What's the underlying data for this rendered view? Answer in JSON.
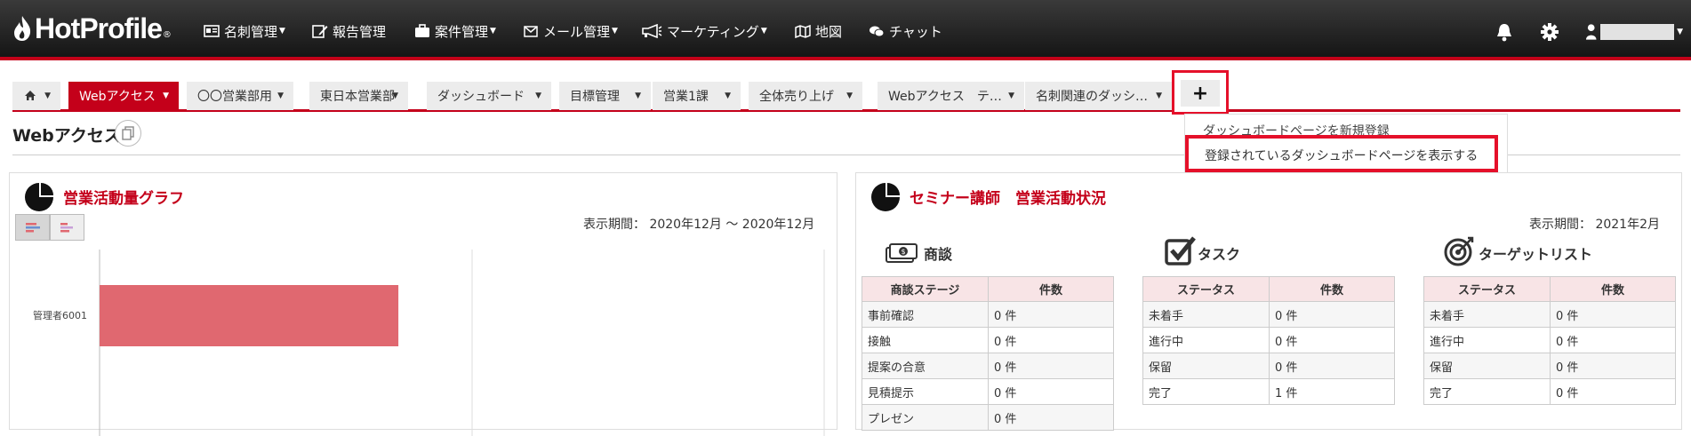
{
  "header": {
    "logo_text": "HotProfile",
    "logo_mark": "®",
    "nav": [
      {
        "label": "名刺管理",
        "icon": "card-icon",
        "caret": true
      },
      {
        "label": "報告管理",
        "icon": "report-icon",
        "caret": false
      },
      {
        "label": "案件管理",
        "icon": "briefcase-icon",
        "caret": true
      },
      {
        "label": "メール管理",
        "icon": "mail-icon",
        "caret": true
      },
      {
        "label": "マーケティング",
        "icon": "megaphone-icon",
        "caret": true
      },
      {
        "label": "地図",
        "icon": "map-icon",
        "caret": false
      },
      {
        "label": "チャット",
        "icon": "chat-icon",
        "caret": false
      }
    ]
  },
  "tabs": [
    {
      "label": "",
      "icon": "home-icon",
      "active": false
    },
    {
      "label": "Webアクセス",
      "active": true
    },
    {
      "label": "〇〇営業部用",
      "active": false
    },
    {
      "label": "東日本営業部",
      "active": false
    },
    {
      "label": "ダッシュボード",
      "active": false
    },
    {
      "label": "目標管理",
      "active": false
    },
    {
      "label": "営業1課",
      "active": false
    },
    {
      "label": "全体売り上げ",
      "active": false
    },
    {
      "label": "Webアクセス　テ…",
      "active": false
    },
    {
      "label": "名刺関連のダッシ…",
      "active": false
    }
  ],
  "add_tab_label": "+",
  "dropdown": {
    "items": [
      "ダッシュボードページを新規登録",
      "登録されているダッシュボードページを表示する"
    ]
  },
  "page": {
    "title": "Webアクセス"
  },
  "left_panel": {
    "title": "営業活動量グラフ",
    "period": "表示期間：  2020年12月 〜 2020年12月"
  },
  "right_panel": {
    "title": "セミナー講師　営業活動状況",
    "period": "表示期間：  2021年2月",
    "sections": [
      {
        "title": "商談",
        "icon": "money-icon",
        "headers": [
          "商談ステージ",
          "件数"
        ],
        "rows": [
          [
            "事前確認",
            "0 件"
          ],
          [
            "接触",
            "0 件"
          ],
          [
            "提案の合意",
            "0 件"
          ],
          [
            "見積提示",
            "0 件"
          ],
          [
            "プレゼン",
            "0 件"
          ]
        ]
      },
      {
        "title": "タスク",
        "icon": "checkbox-icon",
        "headers": [
          "ステータス",
          "件数"
        ],
        "rows": [
          [
            "未着手",
            "0 件"
          ],
          [
            "進行中",
            "0 件"
          ],
          [
            "保留",
            "0 件"
          ],
          [
            "完了",
            "1 件"
          ]
        ]
      },
      {
        "title": "ターゲットリスト",
        "icon": "target-icon",
        "headers": [
          "ステータス",
          "件数"
        ],
        "rows": [
          [
            "未着手",
            "0 件"
          ],
          [
            "進行中",
            "0 件"
          ],
          [
            "保留",
            "0 件"
          ],
          [
            "完了",
            "0 件"
          ]
        ]
      }
    ]
  },
  "chart_data": {
    "type": "bar",
    "orientation": "horizontal",
    "categories": [
      "管理者6001"
    ],
    "values": [
      1
    ],
    "bar_color": "#e06870",
    "grid": true
  },
  "colors": {
    "accent": "#c4001a",
    "highlight": "#e5102a",
    "header_bg": "#1c1c1c",
    "table_header_bg": "#f8e4e6",
    "bar": "#e06870"
  }
}
